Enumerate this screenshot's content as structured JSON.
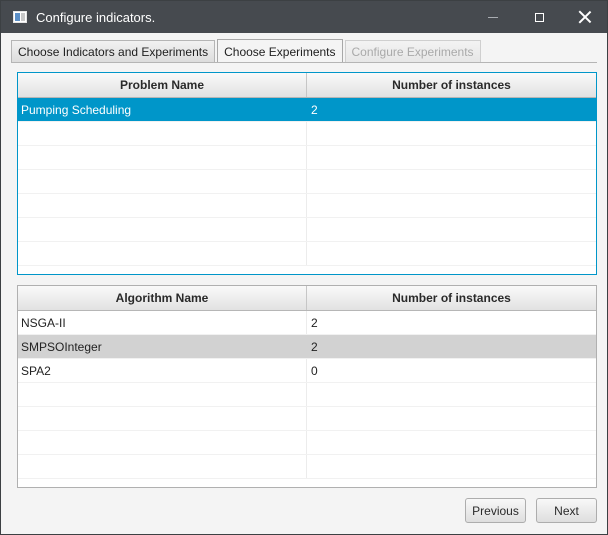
{
  "window": {
    "title": "Configure indicators.",
    "icon": "app-window-icon"
  },
  "tabs": [
    {
      "label": "Choose Indicators and Experiments",
      "state": "normal"
    },
    {
      "label": "Choose Experiments",
      "state": "active"
    },
    {
      "label": "Configure Experiments",
      "state": "disabled"
    }
  ],
  "problems_table": {
    "columns": [
      "Problem Name",
      "Number of instances"
    ],
    "rows": [
      {
        "name": "Pumping Scheduling",
        "instances": "2",
        "selected": true
      }
    ],
    "empty_rows": 6
  },
  "algorithms_table": {
    "columns": [
      "Algorithm Name",
      "Number of instances"
    ],
    "rows": [
      {
        "name": "NSGA-II",
        "instances": "2"
      },
      {
        "name": "SMPSOInteger",
        "instances": "2",
        "highlighted": true
      },
      {
        "name": "SPA2",
        "instances": "0"
      }
    ],
    "empty_rows": 4
  },
  "buttons": {
    "previous": "Previous",
    "next": "Next"
  },
  "colors": {
    "titlebar": "#464a4f",
    "selection": "#0096c9",
    "row_highlight": "#d2d2d2"
  }
}
